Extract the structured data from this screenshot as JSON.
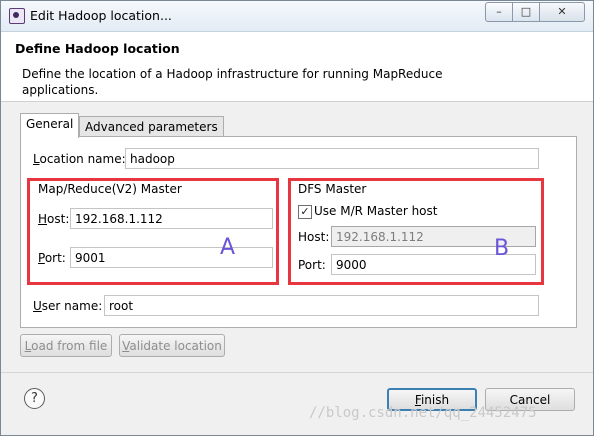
{
  "window": {
    "title": "Edit Hadoop location...",
    "controls": {
      "minimize": "–",
      "maximize": "□",
      "close": "✕"
    }
  },
  "header": {
    "title": "Define Hadoop location",
    "description": "Define the location of a Hadoop infrastructure for running MapReduce applications."
  },
  "tabs": [
    {
      "label": "General",
      "active": true
    },
    {
      "label": "Advanced parameters",
      "active": false
    }
  ],
  "general": {
    "location_name": {
      "label_mnemonic": "L",
      "label_rest": "ocation name:",
      "value": "hadoop"
    },
    "mr_master": {
      "title": "Map/Reduce(V2) Master",
      "host_label_mnemonic": "H",
      "host_label_rest": "ost:",
      "host_value": "192.168.1.112",
      "port_label_mnemonic": "P",
      "port_label_rest": "ort:",
      "port_value": "9001",
      "annotation": "A"
    },
    "dfs_master": {
      "title": "DFS Master",
      "use_mr_host_label": "Use M/R Master host",
      "use_mr_host_checked": true,
      "host_label": "Host:",
      "host_value": "192.168.1.112",
      "port_label": "Port:",
      "port_value": "9000",
      "annotation": "B"
    },
    "user_name": {
      "label_mnemonic": "U",
      "label_rest": "ser name:",
      "value": "root"
    }
  },
  "actions": {
    "load_from_file_mnemonic": "L",
    "load_from_file_rest": "oad from file",
    "validate_location_mnemonic": "V",
    "validate_location_rest": "alidate location"
  },
  "footer": {
    "help": "?",
    "finish_mnemonic": "F",
    "finish_rest": "inish",
    "cancel": "Cancel"
  },
  "watermark": "//blog.csdn.net/qq_24452475",
  "colors": {
    "annotation_box": "#e7363f",
    "annotation_letter": "#6a55d9",
    "default_button_border": "#3c7fb1"
  }
}
